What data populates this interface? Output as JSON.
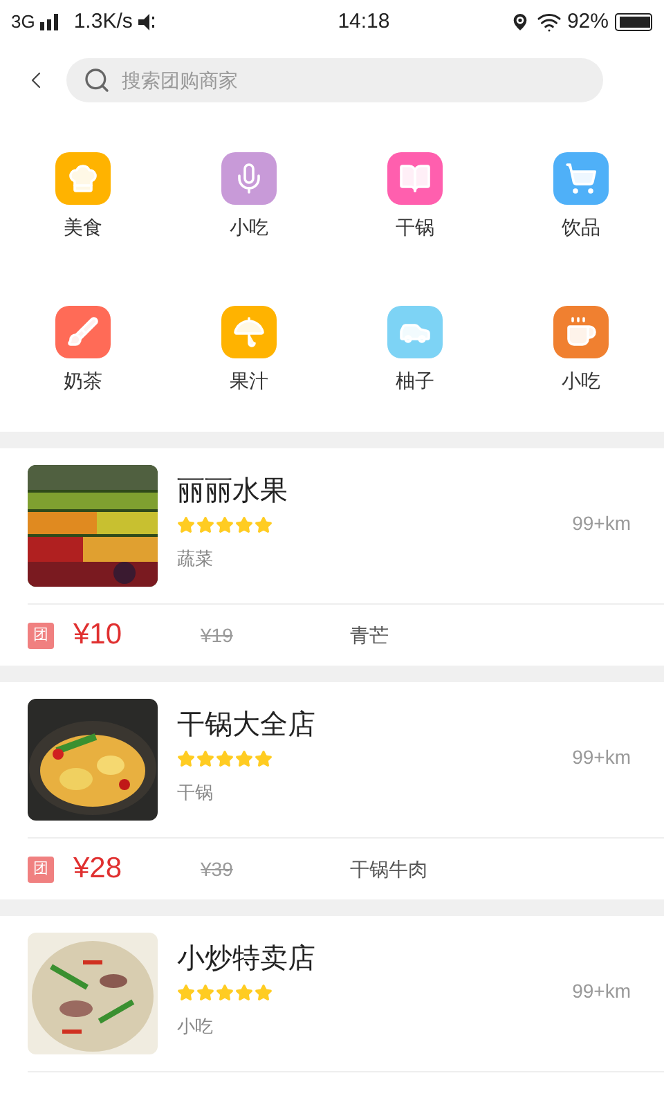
{
  "status_bar": {
    "network": "3G",
    "speed": "1.3K/s",
    "time": "14:18",
    "battery": "92%"
  },
  "search": {
    "placeholder": "搜索团购商家"
  },
  "categories": [
    {
      "label": "美食",
      "color": "#ffb300"
    },
    {
      "label": "小吃",
      "color": "#c89ad8"
    },
    {
      "label": "干锅",
      "color": "#ff5fae"
    },
    {
      "label": "饮品",
      "color": "#4fb0f8"
    },
    {
      "label": "奶茶",
      "color": "#ff6b57"
    },
    {
      "label": "果汁",
      "color": "#ffb300"
    },
    {
      "label": "柚子",
      "color": "#7dd3f5"
    },
    {
      "label": "小吃",
      "color": "#f08030"
    }
  ],
  "shops": [
    {
      "name": "丽丽水果",
      "stars": 5,
      "category": "蔬菜",
      "distance": "99+km",
      "badge": "团",
      "price": "¥10",
      "original_price": "¥19",
      "deal": "青芒"
    },
    {
      "name": "干锅大全店",
      "stars": 5,
      "category": "干锅",
      "distance": "99+km",
      "badge": "团",
      "price": "¥28",
      "original_price": "¥39",
      "deal": "干锅牛肉"
    },
    {
      "name": "小炒特卖店",
      "stars": 5,
      "category": "小吃",
      "distance": "99+km"
    }
  ]
}
